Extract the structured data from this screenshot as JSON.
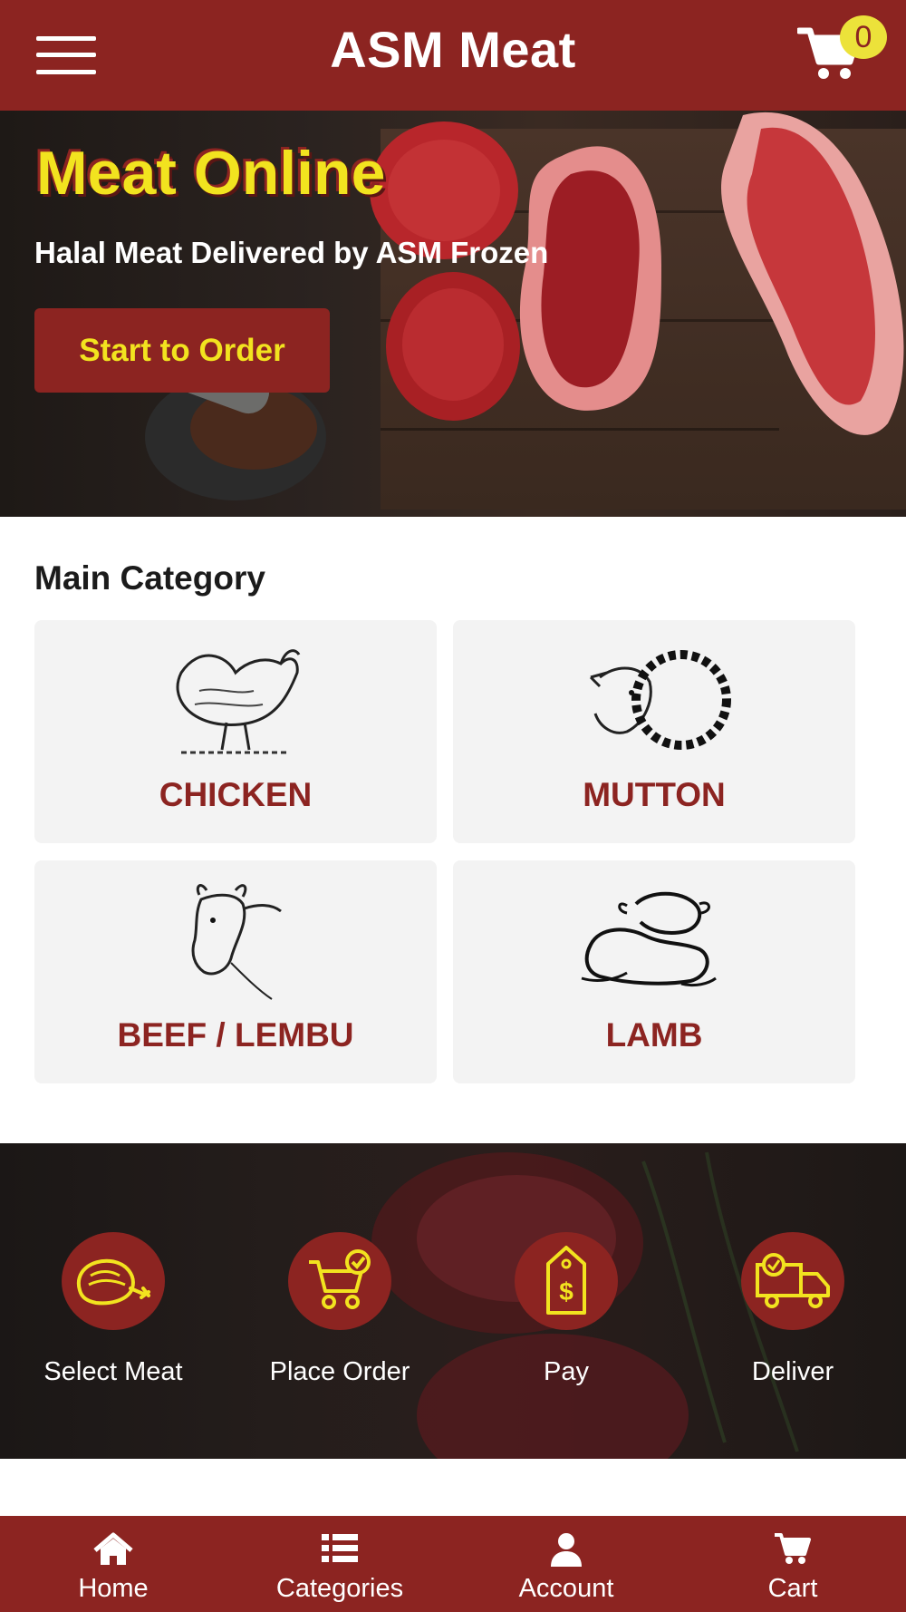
{
  "header": {
    "title": "ASM Meat",
    "menu_icon": "hamburger-icon",
    "cart_icon": "cart-icon",
    "cart_count": "0"
  },
  "hero": {
    "title": "Meat Online",
    "subtitle": "Halal Meat Delivered by ASM Frozen",
    "cta_label": "Start to Order"
  },
  "categories": {
    "title": "Main Category",
    "items": [
      {
        "label": "CHICKEN",
        "icon": "chicken-illustration"
      },
      {
        "label": "MUTTON",
        "icon": "sheep-illustration"
      },
      {
        "label": "BEEF / LEMBU",
        "icon": "cow-illustration"
      },
      {
        "label": "LAMB",
        "icon": "lamb-illustration"
      }
    ]
  },
  "steps": {
    "items": [
      {
        "label": "Select Meat",
        "icon": "meat-leg-icon"
      },
      {
        "label": "Place Order",
        "icon": "cart-check-icon"
      },
      {
        "label": "Pay",
        "icon": "price-tag-icon"
      },
      {
        "label": "Deliver",
        "icon": "delivery-truck-icon"
      }
    ]
  },
  "bottom_nav": {
    "items": [
      {
        "label": "Home",
        "icon": "home-icon"
      },
      {
        "label": "Categories",
        "icon": "list-icon"
      },
      {
        "label": "Account",
        "icon": "user-icon"
      },
      {
        "label": "Cart",
        "icon": "cart-icon"
      }
    ]
  },
  "colors": {
    "brand": "#8c2421",
    "accent": "#f2e31f",
    "card": "#f3f3f3"
  }
}
